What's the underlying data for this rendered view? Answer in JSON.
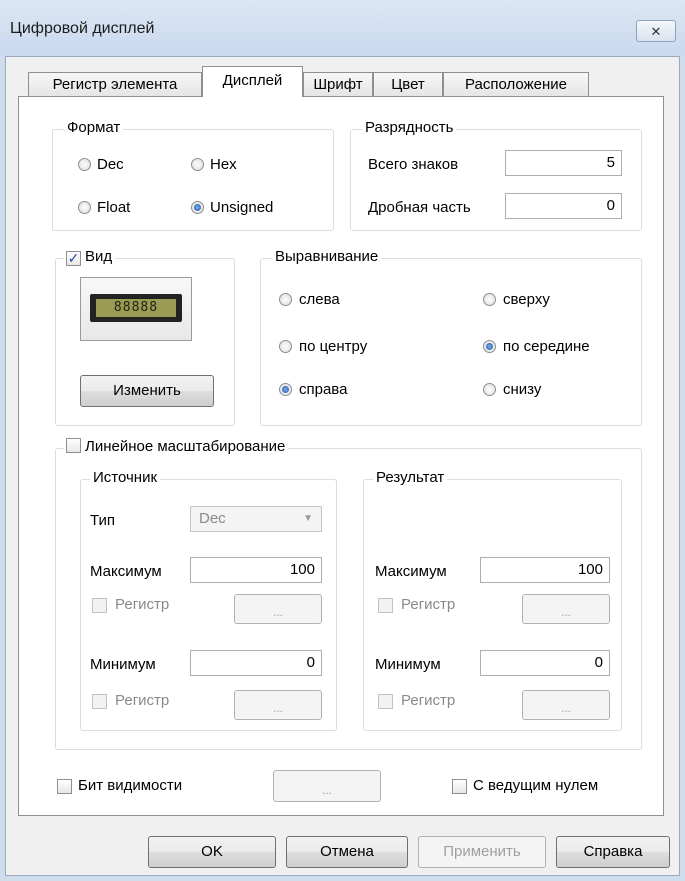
{
  "window": {
    "title": "Цифровой дисплей",
    "close_icon": "close-icon"
  },
  "tabs": [
    {
      "label": "Регистр элемента",
      "active": false
    },
    {
      "label": "Дисплей",
      "active": true
    },
    {
      "label": "Шрифт",
      "active": false
    },
    {
      "label": "Цвет",
      "active": false
    },
    {
      "label": "Расположение",
      "active": false
    }
  ],
  "format": {
    "title": "Формат",
    "options": [
      {
        "label": "Dec",
        "selected": false
      },
      {
        "label": "Hex",
        "selected": false
      },
      {
        "label": "Float",
        "selected": false
      },
      {
        "label": "Unsigned",
        "selected": true
      }
    ]
  },
  "digits": {
    "title": "Разрядность",
    "total_label": "Всего знаков",
    "total_value": "5",
    "fraction_label": "Дробная часть",
    "fraction_value": "0"
  },
  "view": {
    "label": "Вид",
    "checked": true,
    "preview_digits": "88888",
    "change_button": "Изменить"
  },
  "alignment": {
    "title": "Выравнивание",
    "options": [
      {
        "label": "слева",
        "selected": false
      },
      {
        "label": "сверху",
        "selected": false
      },
      {
        "label": "по центру",
        "selected": false
      },
      {
        "label": "по середине",
        "selected": true
      },
      {
        "label": "справа",
        "selected": true
      },
      {
        "label": "снизу",
        "selected": false
      }
    ]
  },
  "scaling": {
    "label": "Линейное масштабирование",
    "checked": false,
    "source": {
      "title": "Источник",
      "type_label": "Тип",
      "type_value": "Dec",
      "max_label": "Максимум",
      "max_value": "100",
      "min_label": "Минимум",
      "min_value": "0",
      "register_label": "Регистр",
      "browse_label": "..."
    },
    "result": {
      "title": "Результат",
      "max_label": "Максимум",
      "max_value": "100",
      "min_label": "Минимум",
      "min_value": "0",
      "register_label": "Регистр",
      "browse_label": "..."
    }
  },
  "visibility_bit": {
    "label": "Бит видимости",
    "checked": false,
    "browse_label": "..."
  },
  "leading_zero": {
    "label": "С ведущим нулем",
    "checked": false
  },
  "buttons": {
    "ok": "OK",
    "cancel": "Отмена",
    "apply": "Применить",
    "help": "Справка"
  },
  "colors": {
    "accent": "#1a4fa0",
    "frame": "#cfdcec"
  }
}
